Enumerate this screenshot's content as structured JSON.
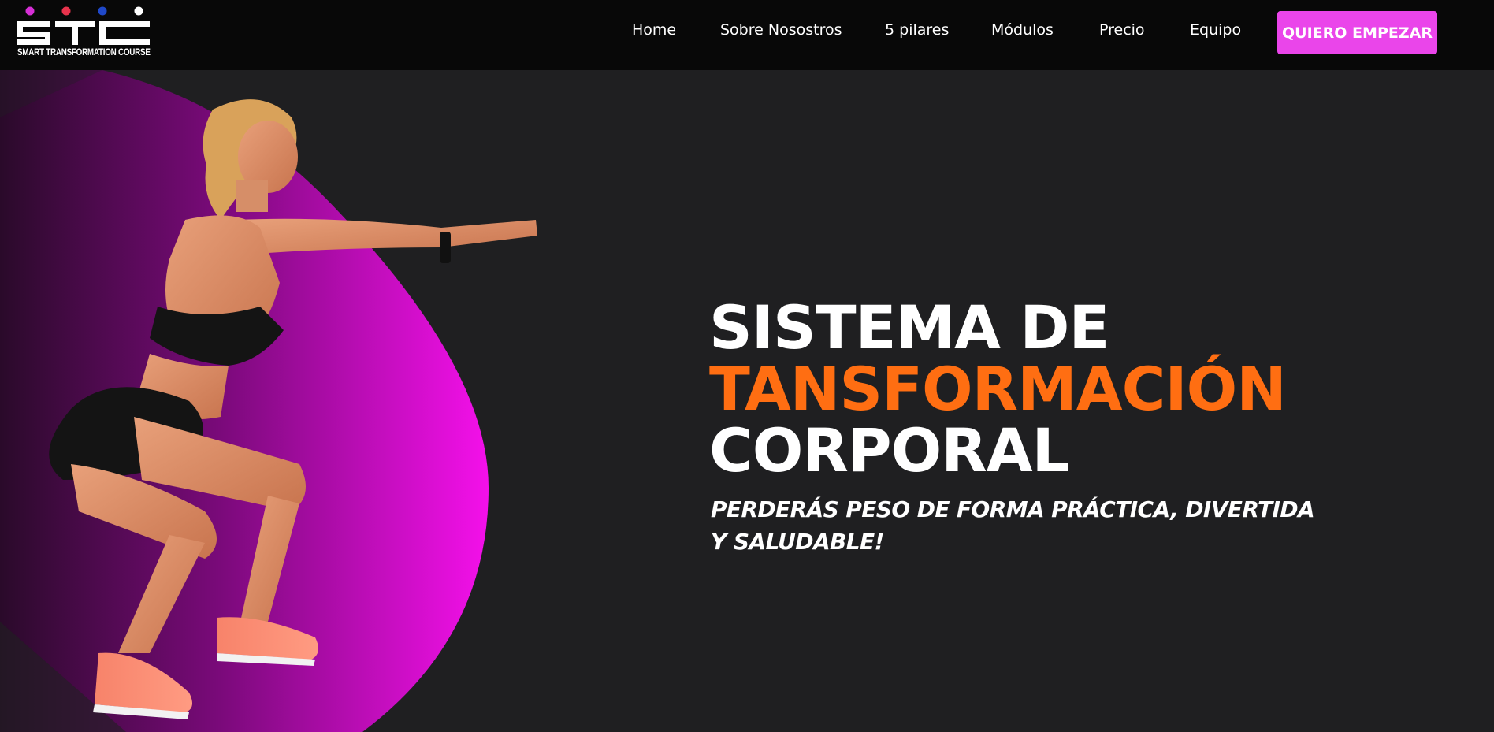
{
  "brand": {
    "logo_letters": "STC",
    "logo_subtitle": "SMART TRANSFORMATION COURSE",
    "dot_colors": [
      "#d62fd6",
      "#e8334c",
      "#1f48c9",
      "#ffffff"
    ]
  },
  "nav": {
    "items": [
      {
        "label": "Home"
      },
      {
        "label": "Sobre Nosostros"
      },
      {
        "label": "5 pilares"
      },
      {
        "label": "Módulos"
      },
      {
        "label": "Precio"
      },
      {
        "label": "Equipo"
      }
    ],
    "cta_label": "QUIERO EMPEZAR"
  },
  "hero": {
    "headline_line1": "SISTEMA DE",
    "headline_line2": "TANSFORMACIÓN",
    "headline_line3": "CORPORAL",
    "tagline": "PERDERÁS PESO DE FORMA PRÁCTICA, DIVERTIDA Y SALUDABLE!",
    "image_subject": "woman-doing-squat-photo"
  },
  "colors": {
    "accent_orange": "#ff6e12",
    "cta_pink": "#ea45ea",
    "circle_magenta": "#f010e8",
    "background": "#1f1f21",
    "header": "#080808"
  }
}
